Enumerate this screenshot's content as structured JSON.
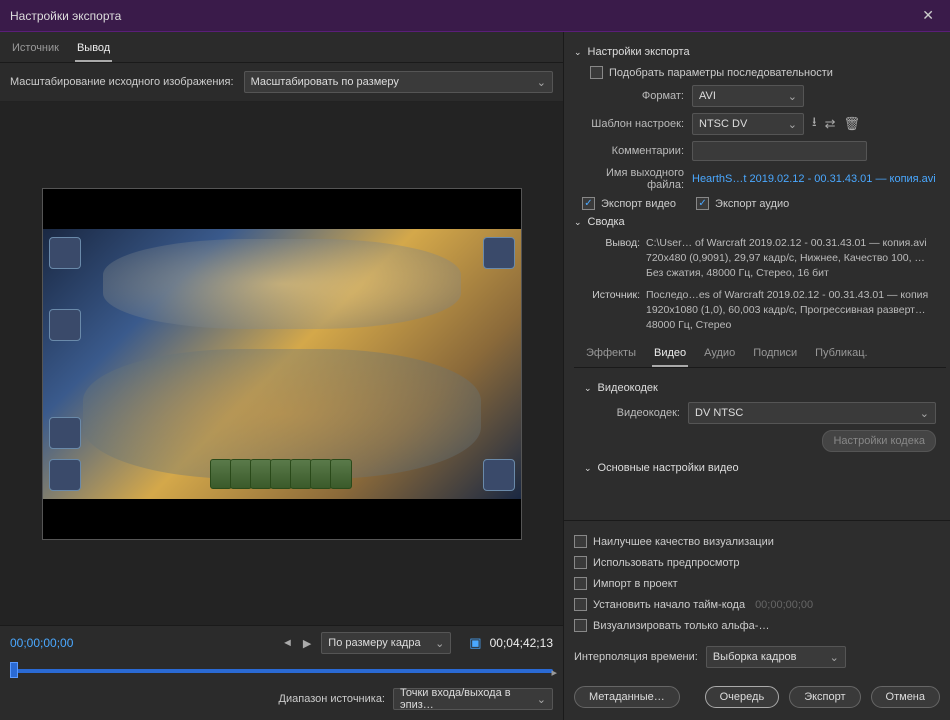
{
  "dialog": {
    "title": "Настройки экспорта"
  },
  "left": {
    "tabs": {
      "source": "Источник",
      "output": "Вывод"
    },
    "scale_label": "Масштабирование исходного изображения:",
    "scale_value": "Масштабировать по размеру",
    "timecode": "00;00;00;00",
    "duration": "00;04;42;13",
    "fit_label": "По размеру кадра",
    "source_range_label": "Диапазон источника:",
    "source_range_value": "Точки входа/выхода в эпиз…"
  },
  "export_settings": {
    "title": "Настройки экспорта",
    "match_sequence": "Подобрать параметры последовательности",
    "format_label": "Формат:",
    "format_value": "AVI",
    "preset_label": "Шаблон настроек:",
    "preset_value": "NTSC DV",
    "comments_label": "Комментарии:",
    "output_name_label": "Имя выходного файла:",
    "output_name_value": "HearthS…t 2019.02.12 - 00.31.43.01 — копия.avi",
    "export_video": "Экспорт видео",
    "export_audio": "Экспорт аудио"
  },
  "summary": {
    "title": "Сводка",
    "output_label": "Вывод:",
    "output_text": "C:\\User… of Warcraft 2019.02.12 - 00.31.43.01 — копия.avi\n720x480 (0,9091), 29,97 кадр/с, Нижнее, Качество 100, …\nБез сжатия, 48000 Гц, Стерео, 16 бит",
    "source_label": "Источник:",
    "source_text": "Последо…es of Warcraft 2019.02.12 - 00.31.43.01 — копия\n1920x1080 (1,0), 60,003 кадр/с, Прогрессивная разверт…\n48000 Гц, Стерео"
  },
  "sub_tabs": {
    "effects": "Эффекты",
    "video": "Видео",
    "audio": "Аудио",
    "captions": "Подписи",
    "publish": "Публикац."
  },
  "video_panel": {
    "codec_section": "Видеокодек",
    "codec_label": "Видеокодек:",
    "codec_value": "DV NTSC",
    "codec_settings": "Настройки кодека",
    "basic_section": "Основные настройки видео"
  },
  "bottom": {
    "best_quality": "Наилучшее качество визуализации",
    "use_preview": "Использовать предпросмотр",
    "import_project": "Импорт в проект",
    "set_start_tc": "Установить начало тайм-кода",
    "tc_placeholder": "00;00;00;00",
    "render_alpha": "Визуализировать только альфа-…",
    "interp_label": "Интерполяция времени:",
    "interp_value": "Выборка кадров"
  },
  "buttons": {
    "metadata": "Метаданные…",
    "queue": "Очередь",
    "export": "Экспорт",
    "cancel": "Отмена"
  }
}
